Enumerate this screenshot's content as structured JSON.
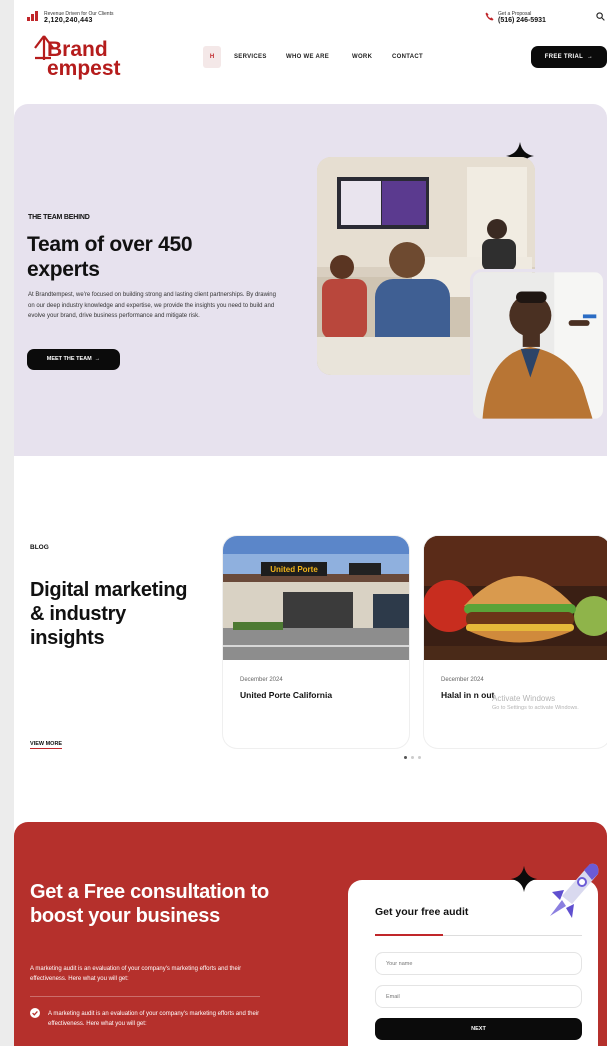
{
  "topbar": {
    "revenue_caption": "Revenue Driven for Our Clients",
    "revenue_value": "2,120,240,443",
    "proposal_caption": "Get a Proposal",
    "proposal_phone": "(516) 246-5931"
  },
  "brand": {
    "logo_line1": "Brand",
    "logo_line2": "empest",
    "primary_color": "#c0262a"
  },
  "nav": {
    "home_label": "H",
    "items": [
      "SERVICES",
      "WHO WE ARE",
      "WORK",
      "CONTACT"
    ],
    "cta_label": "FREE TRIAL"
  },
  "team": {
    "kicker": "THE TEAM BEHIND",
    "title": "Team of over 450 experts",
    "description": "At Brandtempest, we're focused on building strong and lasting client partnerships. By drawing on our deep industry knowledge and expertise, we provide the insights you need to build and evolve your brand, drive business performance and mitigate risk.",
    "button_label": "MEET THE TEAM",
    "background": "#e7e2ee"
  },
  "blog": {
    "kicker": "BLOG",
    "title": "Digital marketing & industry insights",
    "view_more_label": "VIEW MORE",
    "cards": [
      {
        "date": "December 2024",
        "title": "United Porte California",
        "sign_text": "United Porte"
      },
      {
        "date": "December 2024",
        "title": "Halal in n out"
      }
    ],
    "carousel": {
      "pages": 3,
      "active": 1
    }
  },
  "os_watermark": {
    "line1": "Activate Windows",
    "line2": "Go to Settings to activate Windows."
  },
  "consult": {
    "title": "Get a Free consultation to boost your business",
    "description": "A marketing audit is an evaluation of your company's marketing efforts and their effectiveness. Here what you will get:",
    "check_item": "A marketing audit is an evaluation of your company's marketing efforts and their effectiveness. Here what you will get:",
    "background": "#b5302c",
    "form": {
      "title": "Get your free audit",
      "name_placeholder": "Your name",
      "email_placeholder": "Email",
      "submit_label": "NEXT"
    }
  },
  "icons": [
    "bar-chart-icon",
    "phone-icon",
    "search-icon",
    "arrow-right-icon",
    "sparkle-icon",
    "check-circle-icon",
    "rocket-icon"
  ]
}
